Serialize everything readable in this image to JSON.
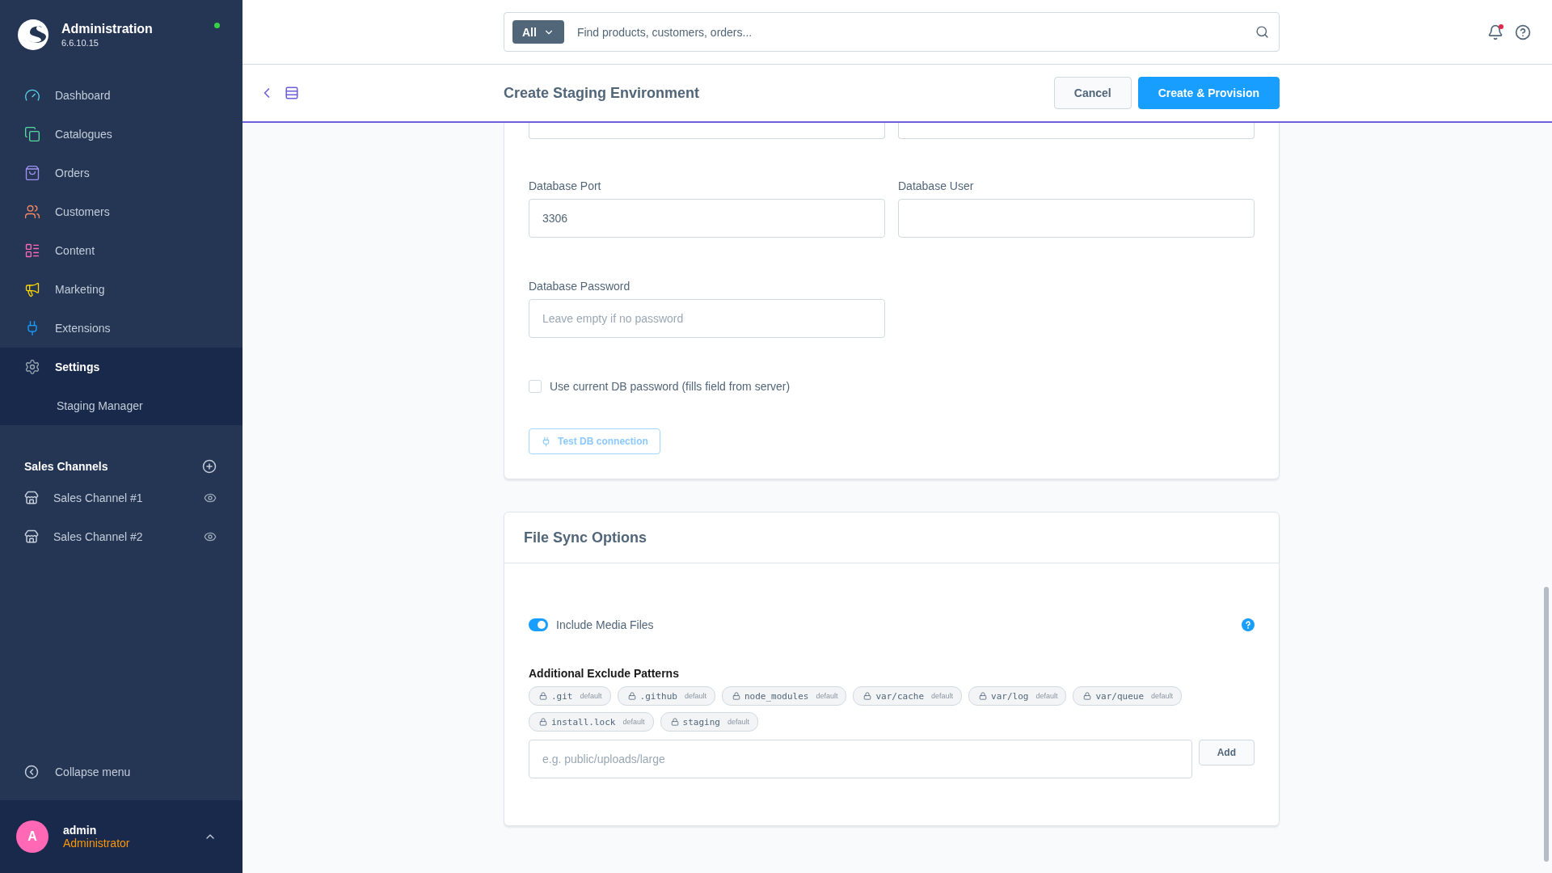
{
  "sidebar": {
    "brand": {
      "title": "Administration",
      "version": "6.6.10.15",
      "online": true
    },
    "nav": [
      {
        "label": "Dashboard",
        "kind": "dashboard",
        "color": "#57d0e8",
        "selected": false
      },
      {
        "label": "Catalogues",
        "kind": "catalogues",
        "color": "#57d9a3",
        "selected": false
      },
      {
        "label": "Orders",
        "kind": "orders",
        "color": "#a092f0",
        "selected": false
      },
      {
        "label": "Customers",
        "kind": "customers",
        "color": "#f88962",
        "selected": false
      },
      {
        "label": "Content",
        "kind": "content",
        "color": "#ff68b4",
        "selected": false
      },
      {
        "label": "Marketing",
        "kind": "marketing",
        "color": "#ffd700",
        "selected": false
      },
      {
        "label": "Extensions",
        "kind": "extensions",
        "color": "#189eff",
        "selected": false
      },
      {
        "label": "Settings",
        "kind": "settings",
        "color": "#9aa8b5",
        "selected": true,
        "children": [
          {
            "label": "Staging Manager"
          }
        ]
      }
    ],
    "sales_channels": {
      "title": "Sales Channels",
      "items": [
        {
          "label": "Sales Channel #1"
        },
        {
          "label": "Sales Channel #2"
        }
      ]
    },
    "collapse": "Collapse menu",
    "user": {
      "initial": "A",
      "name": "admin",
      "role": "Administrator"
    }
  },
  "topbar": {
    "scope": "All",
    "placeholder": "Find products, customers, orders...",
    "notification": true
  },
  "page": {
    "title": "Create Staging Environment",
    "actions": [
      {
        "label": "Cancel",
        "kind": "secondary"
      },
      {
        "label": "Create & Provision",
        "kind": "primary"
      }
    ]
  },
  "db_card": {
    "rows": [
      [
        {
          "label": "Database Port",
          "value": "3306"
        },
        {
          "label": "Database User"
        }
      ],
      [
        {
          "label": "Database Password",
          "placeholder": "Leave empty if no password"
        }
      ]
    ],
    "checkbox": {
      "label": "Use current DB password (fills field from server)",
      "checked": false
    },
    "test_button": {
      "label": "Test DB connection",
      "disabled": true
    }
  },
  "file_sync": {
    "title": "File Sync Options",
    "toggle": {
      "label": "Include Media Files",
      "on": true
    },
    "patterns_title": "Additional Exclude Patterns",
    "patterns": [
      {
        "name": ".git",
        "tag": "default"
      },
      {
        "name": ".github",
        "tag": "default"
      },
      {
        "name": "node_modules",
        "tag": "default"
      },
      {
        "name": "var/cache",
        "tag": "default"
      },
      {
        "name": "var/log",
        "tag": "default"
      },
      {
        "name": "var/queue",
        "tag": "default"
      },
      {
        "name": "install.lock",
        "tag": "default"
      },
      {
        "name": "staging",
        "tag": "default"
      }
    ],
    "input": {
      "placeholder": "e.g. public/uploads/large"
    },
    "add": "Add"
  }
}
